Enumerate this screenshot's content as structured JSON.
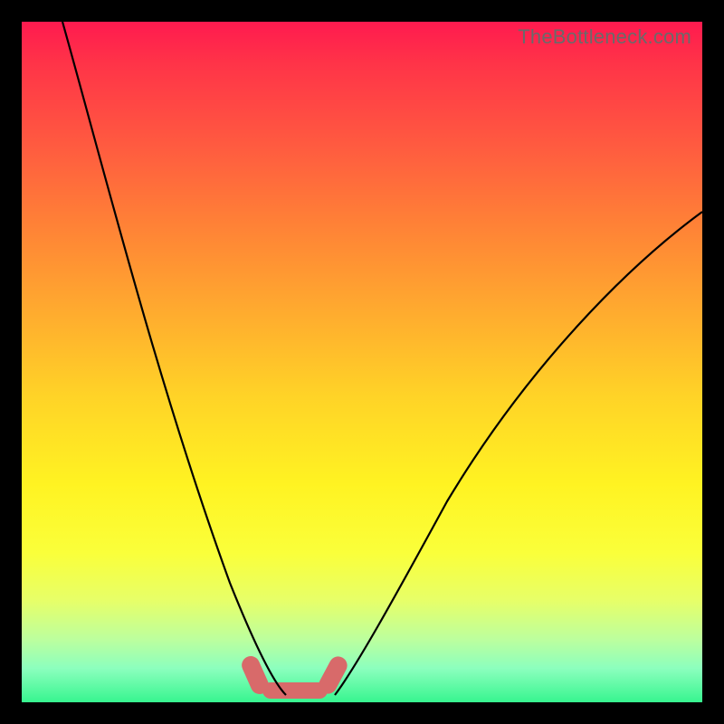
{
  "watermark": "TheBottleneck.com",
  "chart_data": {
    "type": "line",
    "title": "",
    "xlabel": "",
    "ylabel": "",
    "xlim": [
      0,
      100
    ],
    "ylim": [
      0,
      100
    ],
    "grid": false,
    "series": [
      {
        "name": "left-curve",
        "x": [
          6,
          10,
          14,
          18,
          22,
          26,
          30,
          33,
          35,
          37,
          38.5
        ],
        "y": [
          100,
          87,
          73,
          58,
          43,
          29,
          16,
          8,
          4,
          1.5,
          0.8
        ]
      },
      {
        "name": "right-curve",
        "x": [
          46,
          48,
          51,
          55,
          60,
          66,
          73,
          81,
          90,
          100
        ],
        "y": [
          0.8,
          2,
          5,
          11,
          19,
          29,
          40,
          51,
          62,
          72
        ]
      }
    ],
    "highlight_region": {
      "name": "bottleneck-marker",
      "x_start": 33,
      "x_end": 48,
      "color": "#d86a6a"
    },
    "background_gradient": {
      "top": "#ff1a4f",
      "middle": "#ffe326",
      "bottom": "#37f58f"
    }
  }
}
